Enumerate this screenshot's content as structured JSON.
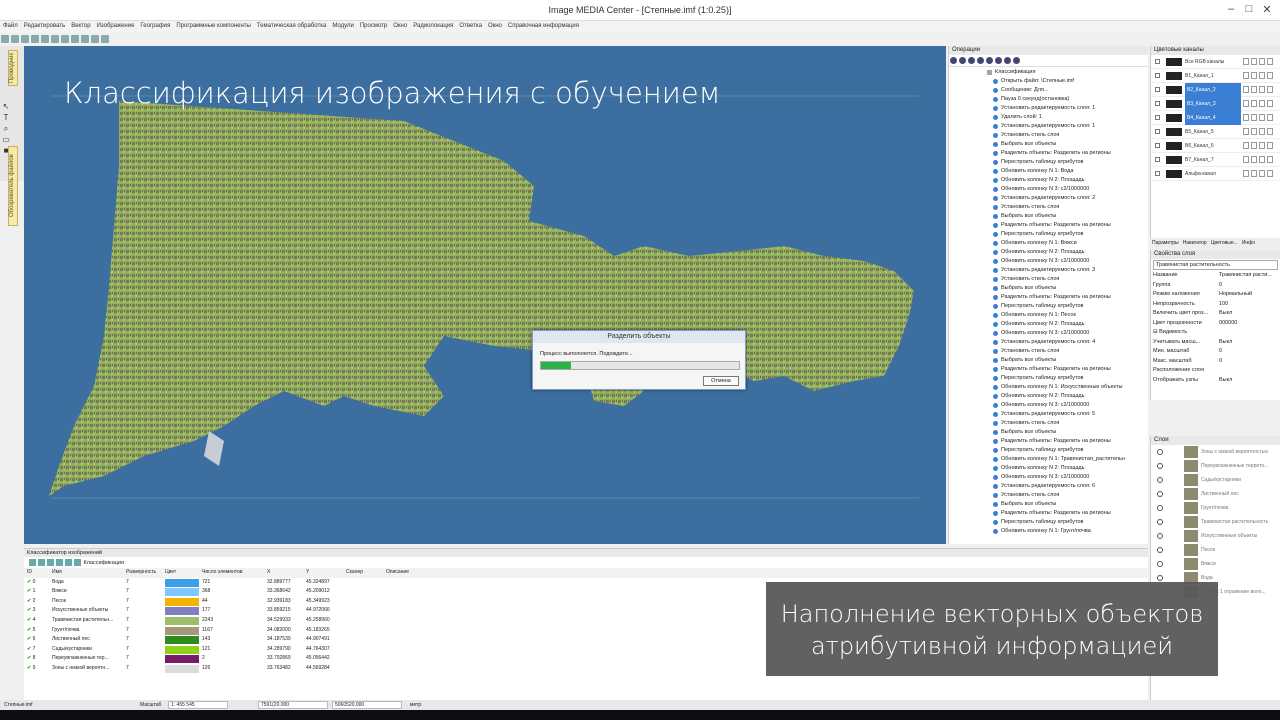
{
  "window": {
    "title": "Image MEDIA Center - [Степные.imf  (1:0.25)]"
  },
  "menu": [
    "Файл",
    "Редактировать",
    "Вектор",
    "Изображение",
    "География",
    "Программные компоненты",
    "Тематическая обработка",
    "Модули",
    "Просмотр",
    "Окно",
    "Радиолокация",
    "Ответка",
    "Окно",
    "Справочная информация"
  ],
  "left_tabs": [
    "Проводник",
    "Обозреватель файлов"
  ],
  "map": {
    "heading": "Классификация изображения с обучением"
  },
  "dialog": {
    "title": "Разделить объекты",
    "message": "Процесс выполняется. Подождите...",
    "progress": 0.15,
    "cancel": "Отмена"
  },
  "operations": {
    "title": "Операции",
    "root": "Классификация",
    "items": [
      "Открыть файл: \\Степные.imf",
      "Сообщение: Для...",
      "Пауза 0 секунд(остановка)",
      "Установить редактируемость слоя: 1",
      "Удалить слой: 1",
      "Установить редактируемость слоя: 1",
      "Установить стиль слоя",
      "Выбрать все объекты",
      "Разделить объекты: Разделить на регионы",
      "Перестроить таблицу атрибутов",
      "Обновить колонку N 1: Вода",
      "Обновить колонку N 2: Площадь",
      "Обновить колонку N 3: c2/1000000",
      "Установить редактируемость слоя: 2",
      "Установить стиль слоя",
      "Выбрать все объекты",
      "Разделить объекты: Разделить на регионы",
      "Перестроить таблицу атрибутов",
      "Обновить колонку N 1: Вяжси",
      "Обновить колонку N 2: Площадь",
      "Обновить колонку N 3: c2/1000000",
      "Установить редактируемость слоя: 3",
      "Установить стиль слоя",
      "Выбрать все объекты",
      "Разделить объекты: Разделить на регионы",
      "Перестроить таблицу атрибутов",
      "Обновить колонку N 1: Песок",
      "Обновить колонку N 2: Площадь",
      "Обновить колонку N 3: c2/1000000",
      "Установить редактируемость слоя: 4",
      "Установить стиль слоя",
      "Выбрать все объекты",
      "Разделить объекты: Разделить на регионы",
      "Перестроить таблицу атрибутов",
      "Обновить колонку N 1: Искусственные объекты",
      "Обновить колонку N 2: Площадь",
      "Обновить колонку N 3: c2/1000000",
      "Установить редактируемость слоя: 5",
      "Установить стиль слоя",
      "Выбрать все объекты",
      "Разделить объекты: Разделить на регионы",
      "Перестроить таблицу атрибутов",
      "Обновить колонку N 1: Травянистая_растительн",
      "Обновить колонку N 2: Площадь",
      "Обновить колонку N 3: c2/1000000",
      "Установить редактируемость слоя: 6",
      "Установить стиль слоя",
      "Выбрать все объекты",
      "Разделить объекты: Разделить на регионы",
      "Перестроить таблицу атрибутов",
      "Обновить колонку N 1: Грунт/почва"
    ]
  },
  "channels": {
    "title": "Цветовые каналы",
    "rows": [
      {
        "name": "Все RGB каналы",
        "selected": false
      },
      {
        "name": "B1_Канал_1",
        "selected": false
      },
      {
        "name": "B2_Канал_2",
        "selected": true
      },
      {
        "name": "B3_Канал_3",
        "selected": true
      },
      {
        "name": "B4_Канал_4",
        "selected": true
      },
      {
        "name": "B5_Канал_5",
        "selected": false
      },
      {
        "name": "B6_Канал_6",
        "selected": false
      },
      {
        "name": "B7_Канал_7",
        "selected": false
      },
      {
        "name": "Альфа-канал",
        "selected": false
      }
    ],
    "tabs": [
      "Параметры",
      "Навигатор",
      "Цветовые...",
      "Инфо"
    ]
  },
  "layer_props": {
    "title": "Свойства слоя",
    "selected_layer": "Травянистая растительность",
    "rows": [
      {
        "k": "Название",
        "v": "Травянистая расти..."
      },
      {
        "k": "Группа",
        "v": "0"
      },
      {
        "k": "Режим наложения",
        "v": "Нормальный"
      },
      {
        "k": "Непрозрачность",
        "v": "100"
      },
      {
        "k": "Включить цвет проз...",
        "v": "Выкл"
      },
      {
        "k": "Цвет прозрачности",
        "v": "000000"
      },
      {
        "k": "⊟ Видимость",
        "v": ""
      },
      {
        "k": "   Учитывать масш...",
        "v": "Выкл"
      },
      {
        "k": "   Мин. масштаб",
        "v": "0"
      },
      {
        "k": "   Макс. масштаб",
        "v": "0"
      },
      {
        "k": "Расположение слоя",
        "v": ""
      },
      {
        "k": "Отображать узлы",
        "v": "Выкл"
      }
    ]
  },
  "layers": {
    "title": "Слои",
    "rows": [
      "Зоны с низкой вероятностью",
      "Переувлажненные террито...",
      "Сады/кустарники",
      "Лиственный лес",
      "Грунт/почва",
      "Травянистая растительность",
      "Искусственные объекты",
      "Песок",
      "Вяжси",
      "Вода",
      "Снимок 1 отражение воло..."
    ]
  },
  "classifier": {
    "title": "Классификатор изображений",
    "toolbar_label": "Классификация",
    "columns": [
      "ID",
      "Имя",
      "Размерность",
      "Цвет",
      "Число элементов",
      "X",
      "Y",
      "Сканер",
      "Описание"
    ],
    "rows": [
      {
        "id": "0",
        "name": "Вода",
        "dim": "7",
        "color": "#3aa0e6",
        "count": "721",
        "x": "32.889777",
        "y": "45.324897"
      },
      {
        "id": "1",
        "name": "Вяжси",
        "dim": "7",
        "color": "#80c7ff",
        "count": "368",
        "x": "33.368642",
        "y": "45.209012"
      },
      {
        "id": "2",
        "name": "Песок",
        "dim": "7",
        "color": "#f2b400",
        "count": "44",
        "x": "32.939183",
        "y": "45.349923"
      },
      {
        "id": "3",
        "name": "Искусственные объекты",
        "dim": "7",
        "color": "#8080c0",
        "count": "177",
        "x": "33.859215",
        "y": "44.972066"
      },
      {
        "id": "4",
        "name": "Травянистая растительн...",
        "dim": "7",
        "color": "#9cc06a",
        "count": "2243",
        "x": "34.529933",
        "y": "45.258960"
      },
      {
        "id": "5",
        "name": "Грунт/почва",
        "dim": "7",
        "color": "#a39a78",
        "count": "1167",
        "x": "34.082000",
        "y": "45.183265"
      },
      {
        "id": "6",
        "name": "Лиственный лес",
        "dim": "7",
        "color": "#2e8b1e",
        "count": "143",
        "x": "34.187539",
        "y": "44.907491"
      },
      {
        "id": "7",
        "name": "Сады/кустарники",
        "dim": "7",
        "color": "#8ed11a",
        "count": "121",
        "x": "34.289790",
        "y": "44.764307"
      },
      {
        "id": "8",
        "name": "Переувлажненные тер...",
        "dim": "7",
        "color": "#7a1a6a",
        "count": "2",
        "x": "33.792869",
        "y": "45.056442"
      },
      {
        "id": "9",
        "name": "Зоны с низкой вероятн...",
        "dim": "7",
        "color": "#dcdcdc",
        "count": "126",
        "x": "33.763482",
        "y": "44.569284"
      }
    ]
  },
  "caption": {
    "line1": "Наполнение векторных объектов",
    "line2": "атрибутивной информацией"
  },
  "status": {
    "file": "Степные.imf",
    "scale_label": "Масштаб",
    "scale_value": "1: 455 545",
    "coord1": "7591(20.000",
    "coord2": "5060520.000",
    "unit": "метр"
  }
}
